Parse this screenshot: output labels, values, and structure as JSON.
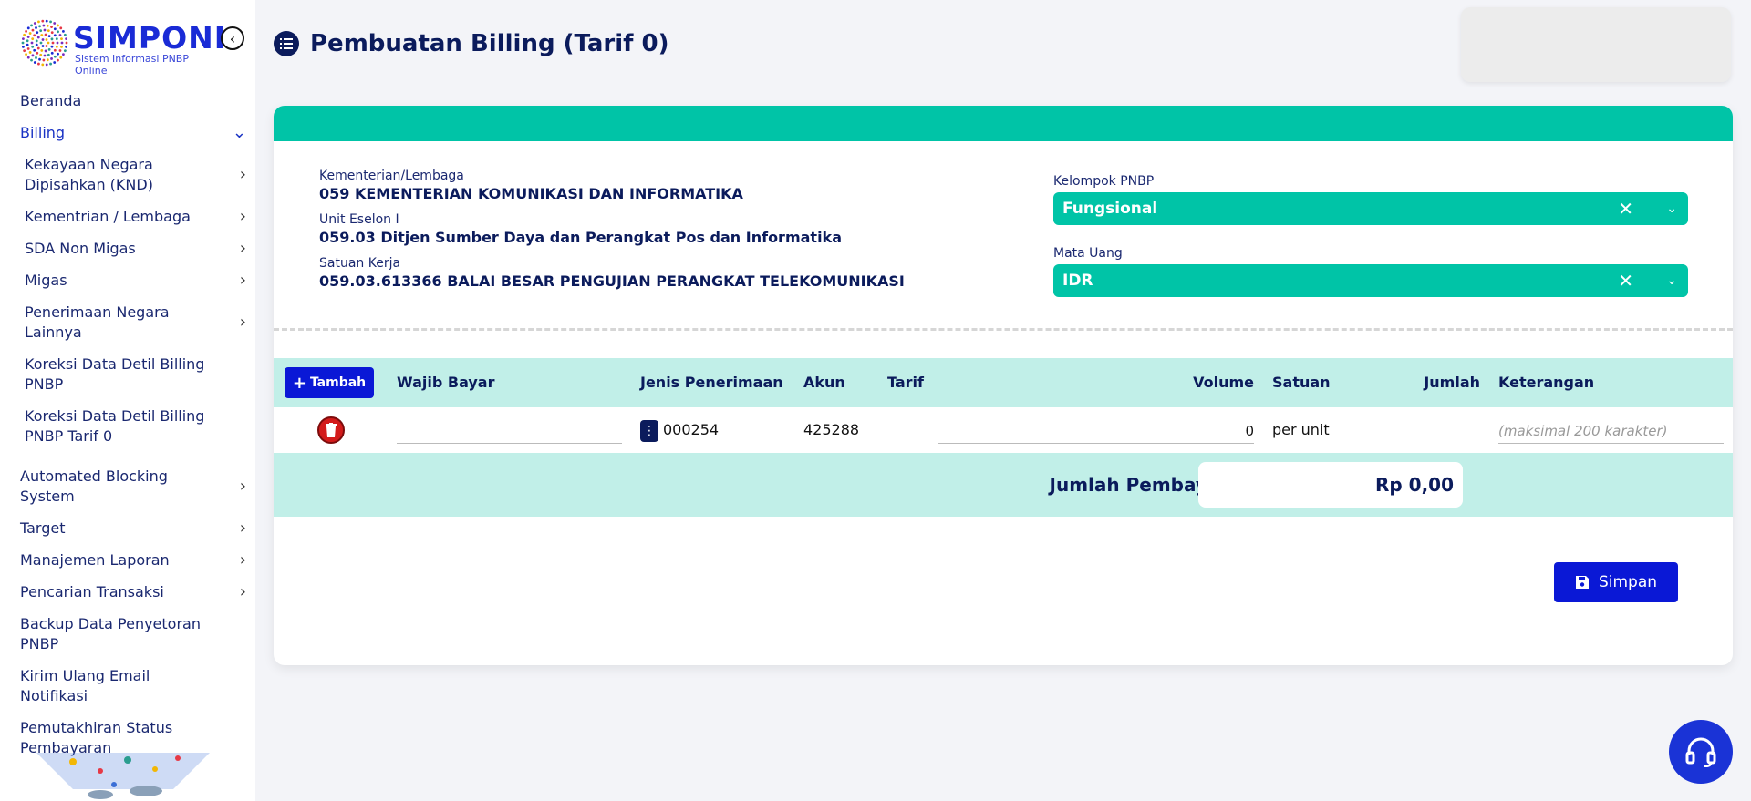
{
  "brand": {
    "name": "SIMPONI",
    "tagline": "Sistem Informasi PNBP Online"
  },
  "header": {
    "title": "Pembuatan Billing (Tarif 0)"
  },
  "sidebar": {
    "items": [
      {
        "label": "Beranda",
        "sub": false,
        "chevron": ""
      },
      {
        "label": "Billing",
        "sub": false,
        "chevron": "down",
        "active": true
      },
      {
        "label": "Kekayaan Negara Dipisahkan (KND)",
        "sub": true,
        "chevron": "right"
      },
      {
        "label": "Kementrian / Lembaga",
        "sub": true,
        "chevron": "right"
      },
      {
        "label": "SDA Non Migas",
        "sub": true,
        "chevron": "right"
      },
      {
        "label": "Migas",
        "sub": true,
        "chevron": "right"
      },
      {
        "label": "Penerimaan Negara Lainnya",
        "sub": true,
        "chevron": "right"
      },
      {
        "label": "Koreksi Data Detil Billing PNBP",
        "sub": true,
        "chevron": ""
      },
      {
        "label": "Koreksi Data Detil Billing PNBP Tarif 0",
        "sub": true,
        "chevron": ""
      },
      {
        "label": "Automated Blocking System",
        "sub": false,
        "chevron": "right"
      },
      {
        "label": "Target",
        "sub": false,
        "chevron": "right"
      },
      {
        "label": "Manajemen Laporan",
        "sub": false,
        "chevron": "right"
      },
      {
        "label": "Pencarian Transaksi",
        "sub": false,
        "chevron": "right"
      },
      {
        "label": "Backup Data Penyetoran PNBP",
        "sub": false,
        "chevron": ""
      },
      {
        "label": "Kirim Ulang Email Notifikasi",
        "sub": false,
        "chevron": ""
      },
      {
        "label": "Pemutakhiran Status Pembayaran",
        "sub": false,
        "chevron": ""
      }
    ]
  },
  "info": {
    "kl_label": "Kementerian/Lembaga",
    "kl_value": "059 KEMENTERIAN KOMUNIKASI DAN INFORMATIKA",
    "eselon_label": "Unit Eselon I",
    "eselon_value": "059.03 Ditjen Sumber Daya dan Perangkat Pos dan Informatika",
    "satker_label": "Satuan Kerja",
    "satker_value": "059.03.613366 BALAI BESAR PENGUJIAN PERANGKAT TELEKOMUNIKASI"
  },
  "form": {
    "kelompok_label": "Kelompok PNBP",
    "kelompok_value": "Fungsional",
    "matauang_label": "Mata Uang",
    "matauang_value": "IDR"
  },
  "table": {
    "add_label": "Tambah",
    "headers": {
      "wajib_bayar": "Wajib Bayar",
      "jenis": "Jenis Penerimaan",
      "akun": "Akun",
      "tarif": "Tarif",
      "volume": "Volume",
      "satuan": "Satuan",
      "jumlah": "Jumlah",
      "keterangan": "Keterangan"
    },
    "row": {
      "wajib_bayar": "",
      "jenis": "000254",
      "akun": "425288",
      "tarif": "",
      "volume": "0",
      "satuan": "per unit",
      "jumlah": "",
      "keterangan_placeholder": "(maksimal 200 karakter)"
    },
    "total_label": "Jumlah Pembayaran",
    "total_value": "Rp 0,00"
  },
  "actions": {
    "save_label": "Simpan"
  },
  "colors": {
    "primary": "#0a18d6",
    "teal": "#00c4a7",
    "teal_light": "#c1efe8",
    "navy": "#0b1b5c",
    "danger": "#d31b1b"
  }
}
